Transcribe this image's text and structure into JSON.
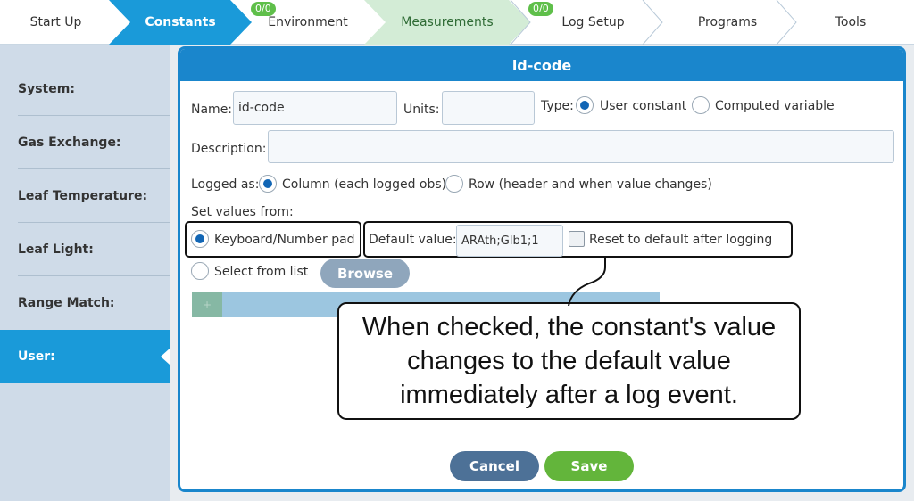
{
  "nav": {
    "tabs": [
      {
        "label": "Start Up"
      },
      {
        "label": "Constants"
      },
      {
        "label": "Environment",
        "badge": "0/0"
      },
      {
        "label": "Measurements"
      },
      {
        "label": "Log Setup",
        "badge": "0/0"
      },
      {
        "label": "Programs"
      },
      {
        "label": "Tools"
      }
    ]
  },
  "sidebar": {
    "items": [
      {
        "label": "System:"
      },
      {
        "label": "Gas Exchange:"
      },
      {
        "label": "Leaf Temperature:"
      },
      {
        "label": "Leaf Light:"
      },
      {
        "label": "Range Match:"
      },
      {
        "label": "User:"
      }
    ]
  },
  "dialog": {
    "title": "id-code",
    "name_label": "Name:",
    "name_value": "id-code",
    "units_label": "Units:",
    "units_value": "",
    "type_label": "Type:",
    "type_options": [
      "User constant",
      "Computed variable"
    ],
    "type_selected": "User constant",
    "description_label": "Description:",
    "description_value": "",
    "logged_as_label": "Logged as:",
    "logged_as_options": [
      "Column (each logged obs)",
      "Row (header and when value changes)"
    ],
    "logged_as_selected": "Column (each logged obs)",
    "set_values_label": "Set values from:",
    "source_options": [
      "Keyboard/Number pad",
      "Select from list"
    ],
    "source_selected": "Keyboard/Number pad",
    "browse_label": "Browse",
    "default_label": "Default value:",
    "default_value": "ARAth;Glb1;1",
    "reset_label": "Reset to default after logging",
    "reset_checked": false,
    "list_add_symbol": "+",
    "cancel_label": "Cancel",
    "save_label": "Save"
  },
  "callout": {
    "text": "When checked, the constant's value changes to the default value immediately after a log event."
  },
  "colors": {
    "accent": "#1a9ad9",
    "dialog_border": "#1a86cc",
    "save": "#63b53b",
    "cancel": "#4d7197",
    "badge": "#5fbf4a"
  }
}
